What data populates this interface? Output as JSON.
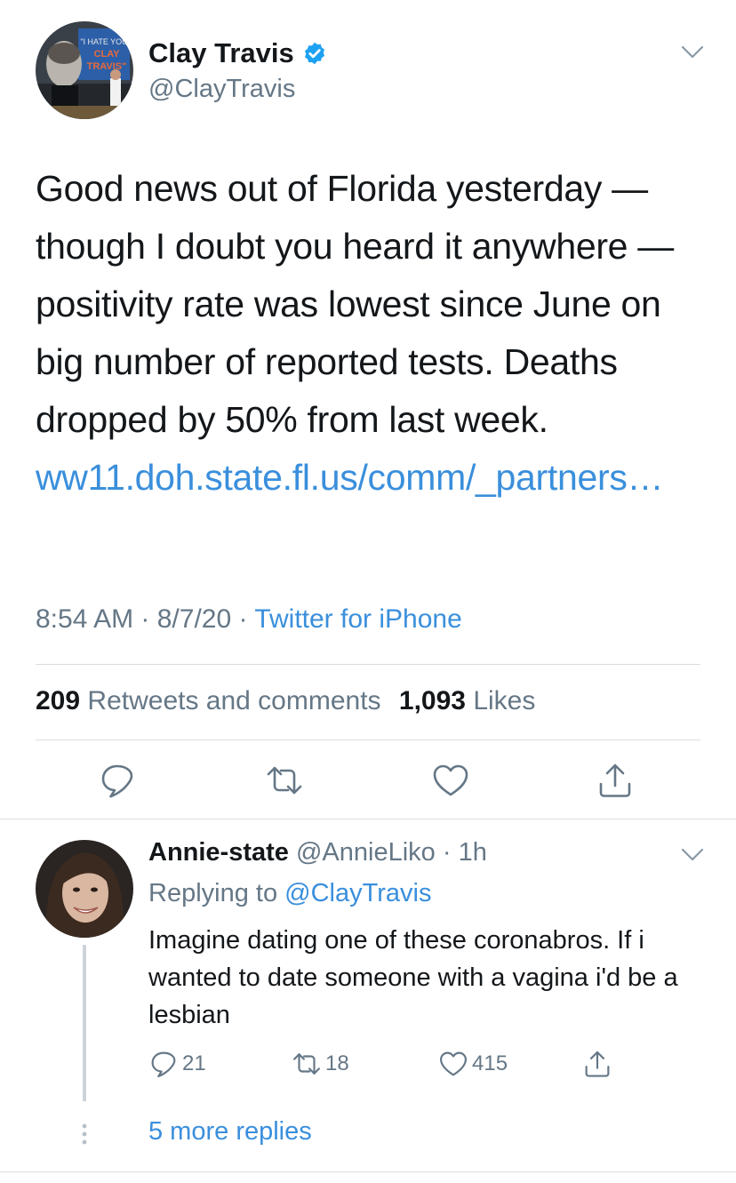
{
  "tweet": {
    "author_name": "Clay Travis",
    "author_handle": "@ClayTravis",
    "avatar_sign_text": [
      "\"I HATE YOU",
      "CLAY",
      "TRAVIS\""
    ],
    "text_before_link": "Good news out of Florida yesterday — though I doubt you heard it anywhere — positivity rate was lowest since June on big number of reported tests. Deaths dropped by 50% from last week. ",
    "link_text": "ww11.doh.state.fl.us/comm/_partners…",
    "time": "8:54 AM",
    "date": "8/7/20",
    "source": "Twitter for iPhone",
    "retweets_count": "209",
    "retweets_label": "Retweets and comments",
    "likes_count": "1,093",
    "likes_label": "Likes"
  },
  "reply": {
    "author_name": "Annie-state",
    "author_handle": "@AnnieLiko",
    "time_ago": "1h",
    "replying_prefix": "Replying to",
    "replying_to": "@ClayTravis",
    "text": "Imagine dating one of these coronabros. If i wanted to date someone with a vagina i'd be a lesbian",
    "reply_count": "21",
    "retweet_count": "18",
    "like_count": "415",
    "more_replies": "5 more replies"
  },
  "icons": {
    "verified": "verified-badge-icon",
    "caret": "chevron-down-icon",
    "reply": "comment-bubble-icon",
    "retweet": "retweet-icon",
    "like": "heart-icon",
    "share": "share-icon"
  },
  "colors": {
    "link": "#3a8fdc",
    "verified": "#1da1f2",
    "secondary_text": "#657786"
  }
}
